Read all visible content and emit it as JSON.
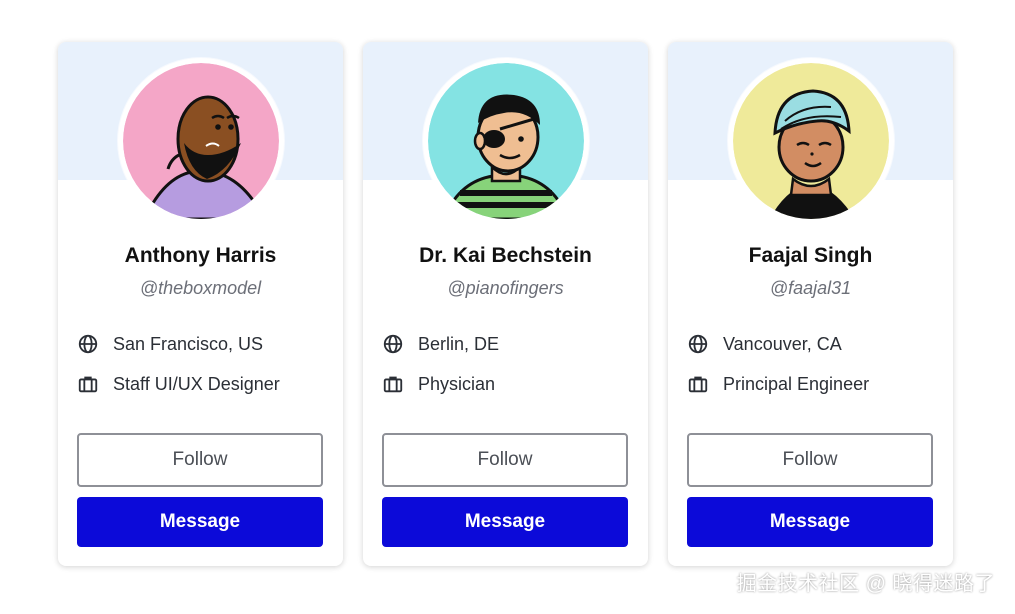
{
  "cards": [
    {
      "name": "Anthony Harris",
      "handle": "@theboxmodel",
      "location": "San Francisco, US",
      "role": "Staff UI/UX Designer",
      "follow_label": "Follow",
      "message_label": "Message",
      "avatar_background": "#F4A6C7"
    },
    {
      "name": "Dr. Kai Bechstein",
      "handle": "@pianofingers",
      "location": "Berlin, DE",
      "role": "Physician",
      "follow_label": "Follow",
      "message_label": "Message",
      "avatar_background": "#84E3E3"
    },
    {
      "name": "Faajal Singh",
      "handle": "@faajal31",
      "location": "Vancouver, CA",
      "role": "Principal Engineer",
      "follow_label": "Follow",
      "message_label": "Message",
      "avatar_background": "#EFEA9A"
    }
  ],
  "icons": {
    "location": "globe-icon",
    "role": "briefcase-icon"
  },
  "colors": {
    "card_header": "#E8F1FC",
    "message_button": "#0C0AD9",
    "follow_border": "#8E9097",
    "handle_text": "#6C6F78"
  },
  "watermark": "掘金技术社区 @ 晓得迷路了"
}
